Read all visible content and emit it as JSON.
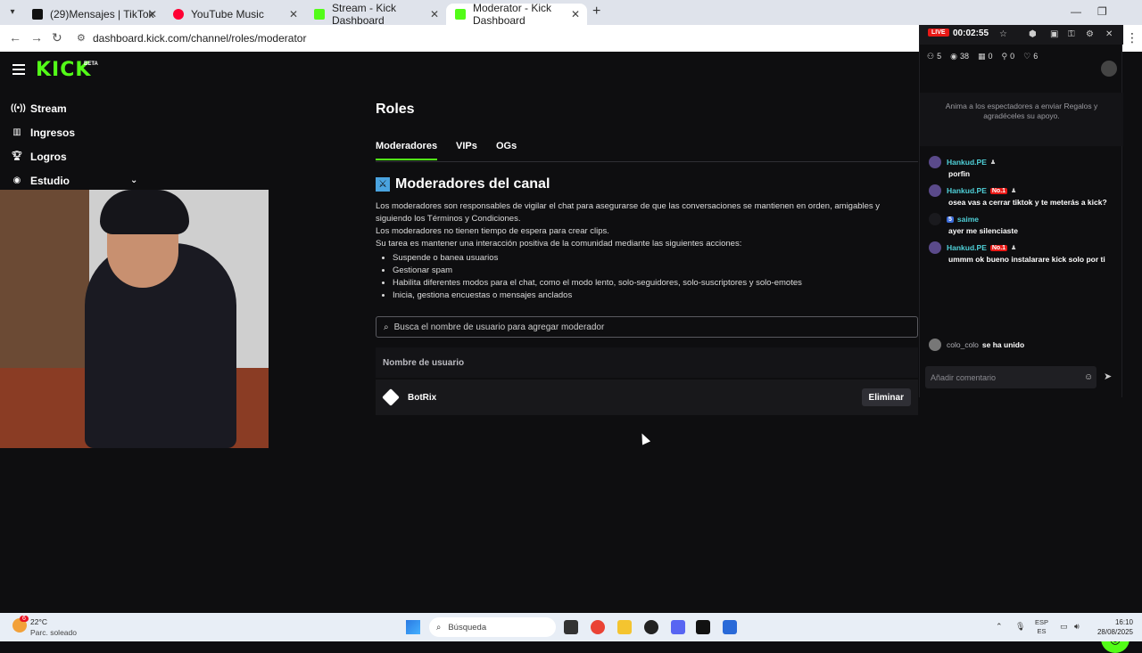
{
  "browser": {
    "tabs": [
      {
        "title": "(29)Mensajes | TikTok",
        "color": "#111111"
      },
      {
        "title": "YouTube Music",
        "color": "#ff0033"
      },
      {
        "title": "Stream - Kick Dashboard",
        "color": "#53fc18"
      },
      {
        "title": "Moderator - Kick Dashboard",
        "color": "#53fc18"
      }
    ],
    "url": "dashboard.kick.com/channel/roles/moderator"
  },
  "brand": {
    "logo": "KICK",
    "beta": "BETA",
    "accent": "#53fc18"
  },
  "sidebar": {
    "items": [
      {
        "label": "Stream",
        "icon": "broadcast-icon"
      },
      {
        "label": "Ingresos",
        "icon": "chart-icon"
      },
      {
        "label": "Logros",
        "icon": "trophy-icon"
      },
      {
        "label": "Estudio",
        "icon": "studio-icon"
      }
    ]
  },
  "main": {
    "title": "Roles",
    "tabs": [
      "Moderadores",
      "VIPs",
      "OGs"
    ],
    "section_title": "Moderadores del canal",
    "description": [
      "Los moderadores son responsables de vigilar el chat para asegurarse de que las conversaciones se mantienen en orden, amigables y siguiendo los Términos y Condiciones.",
      "Los moderadores no tienen tiempo de espera para crear clips.",
      "Su tarea es mantener una interacción positiva de la comunidad mediante las siguientes acciones:"
    ],
    "bullets": [
      "Suspende o banea usuarios",
      "Gestionar spam",
      "Habilita diferentes modos para el chat, como el modo lento, solo-seguidores, solo-suscriptores y solo-emotes",
      "Inicia, gestiona encuestas o mensajes anclados"
    ],
    "search_placeholder": "Busca el nombre de usuario para agregar moderador",
    "table_header": "Nombre de usuario",
    "moderators": [
      {
        "name": "BotRix",
        "action": "Eliminar"
      }
    ]
  },
  "chat": {
    "live": "LIVE",
    "timer": "00:02:55",
    "stats": {
      "followers": "5",
      "viewers": "38",
      "gifts": "0",
      "subs": "0",
      "likes": "6"
    },
    "promo": "Anima a los espectadores a enviar Regalos y agradéceles su apoyo.",
    "messages": [
      {
        "user": "Hankud.PE",
        "badge": "",
        "text": "porfin"
      },
      {
        "user": "Hankud.PE",
        "badge": "No.1",
        "text": "osea vas a cerrar tiktok y te meterás a kick?"
      },
      {
        "user": "saime",
        "badge": "5",
        "text": "ayer me silenciaste"
      },
      {
        "user": "Hankud.PE",
        "badge": "No.1",
        "text": "ummm ok bueno instalarare kick solo por ti"
      }
    ],
    "joined": {
      "user": "colo_colo",
      "text": "se ha unido"
    },
    "input_placeholder": "Añadir comentario"
  },
  "taskbar": {
    "weather_badge": "6",
    "temp": "22°C",
    "condition": "Parc. soleado",
    "search": "Búsqueda",
    "lang_top": "ESP",
    "lang_bottom": "ES",
    "time": "16:10",
    "date": "28/08/2025"
  }
}
